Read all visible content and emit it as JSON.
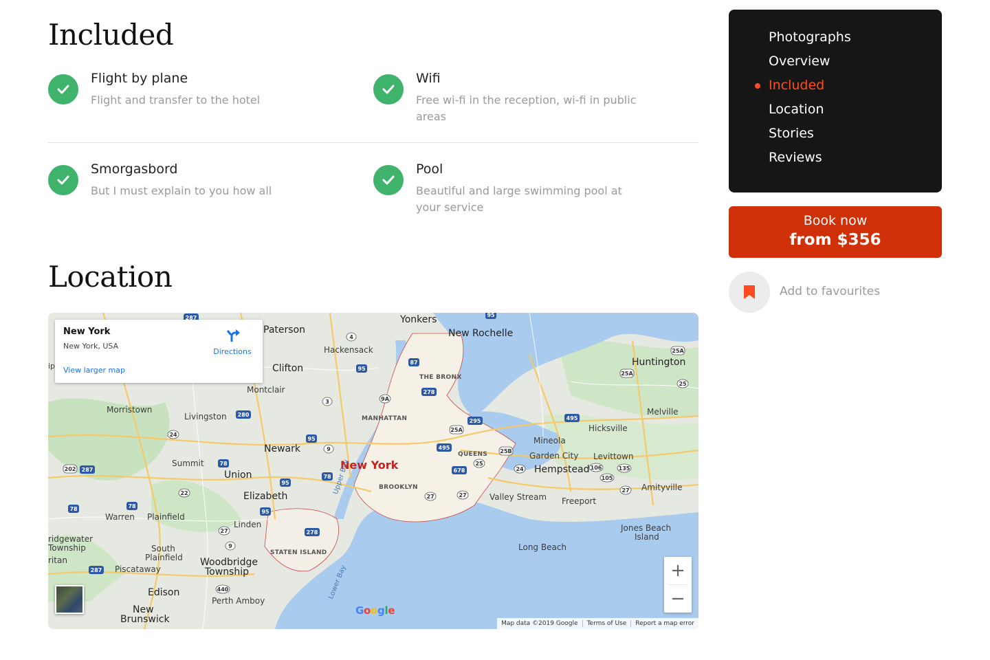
{
  "included": {
    "title": "Included",
    "items": [
      {
        "title": "Flight by plane",
        "desc": "Flight and transfer to the hotel"
      },
      {
        "title": "Wifi",
        "desc": "Free wi-fi in the reception, wi-fi in public areas"
      },
      {
        "title": "Smorgasbord",
        "desc": "But I must explain to you how all"
      },
      {
        "title": "Pool",
        "desc": "Beautiful and large swimming pool at your service"
      }
    ]
  },
  "location": {
    "title": "Location",
    "map": {
      "info_card": {
        "title": "New York",
        "subtitle": "New York, USA",
        "directions_label": "Directions",
        "larger_map_link": "View larger map"
      },
      "labels": {
        "yonkers": "Yonkers",
        "paterson": "Paterson",
        "new_rochelle": "New Rochelle",
        "hackensack": "Hackensack",
        "clifton": "Clifton",
        "huntington": "Huntington",
        "the_bronx": "THE BRONX",
        "montclair": "Montclair",
        "morristown": "Morristown",
        "livingston": "Livingston",
        "manhattan": "MANHATTAN",
        "melville": "Melville",
        "hicksville": "Hicksville",
        "mineola": "Mineola",
        "newark": "Newark",
        "queens": "QUEENS",
        "garden_city": "Garden City",
        "levittown": "Levittown",
        "summit": "Summit",
        "new_york": "New York",
        "hempstead": "Hempstead",
        "union": "Union",
        "brooklyn": "BROOKLYN",
        "amityville": "Amityville",
        "elizabeth": "Elizabeth",
        "valley_stream": "Valley Stream",
        "freeport": "Freeport",
        "warren": "Warren",
        "plainfield": "Plainfield",
        "linden": "Linden",
        "upper_bay": "Upper Bay",
        "jones_beach_1": "Jones Beach",
        "jones_beach_2": "Island",
        "bridgewater_1": "ridgewater",
        "bridgewater_2": "Township",
        "staten_island": "STATEN ISLAND",
        "long_beach": "Long Beach",
        "south_plainfield_1": "South",
        "south_plainfield_2": "Plainfield",
        "woodbridge_1": "Woodbridge",
        "woodbridge_2": "Township",
        "raritan": "ritan",
        "piscataway": "Piscataway",
        "lower_bay": "Lower Bay",
        "edison": "Edison",
        "perth_amboy": "Perth Amboy",
        "new_brunswick_1": "New",
        "new_brunswick_2": "Brunswick",
        "ip": "ip"
      },
      "shields": {
        "s287a": "287",
        "s95a": "95",
        "s4": "4",
        "s87": "87",
        "s95b": "95",
        "s25a_a": "25A",
        "s25a_b": "25A",
        "s278a": "278",
        "s25": "25",
        "s3": "3",
        "s9a": "9A",
        "s280": "280",
        "s295": "295",
        "s495a": "495",
        "s24a": "24",
        "s25a_c": "25A",
        "s95c": "95",
        "s9": "9",
        "s495b": "495",
        "s25b": "25B",
        "s78a": "78",
        "s202": "202",
        "s287b": "287",
        "s678": "678",
        "s25c": "25",
        "s24b": "24",
        "s106": "106",
        "s135": "135",
        "s78b": "78",
        "s95d": "95",
        "s105": "105",
        "s22": "22",
        "s27a": "27",
        "s27b": "27",
        "s27c": "27",
        "s78c": "78",
        "s78d": "78",
        "s95e": "95",
        "s27d": "27",
        "s278b": "278",
        "s9b": "9",
        "s287c": "287",
        "s440": "440"
      },
      "google_logo": [
        "G",
        "o",
        "o",
        "g",
        "l",
        "e"
      ],
      "attribution": [
        "Map data ©2019 Google",
        "Terms of Use",
        "Report a map error"
      ],
      "zoom_in": "+",
      "zoom_out": "−"
    }
  },
  "sidebar": {
    "nav": [
      {
        "label": "Photographs",
        "active": false
      },
      {
        "label": "Overview",
        "active": false
      },
      {
        "label": "Included",
        "active": true
      },
      {
        "label": "Location",
        "active": false
      },
      {
        "label": "Stories",
        "active": false
      },
      {
        "label": "Reviews",
        "active": false
      }
    ],
    "book": {
      "line1": "Book now",
      "line2": "from $356"
    },
    "favourites_label": "Add to favourites"
  },
  "colors": {
    "accent": "#ff4b1f",
    "book_button": "#cf3008",
    "check_green": "#3fb36b",
    "nav_bg": "#161616"
  },
  "icons": {
    "check": "check-icon",
    "bookmark": "bookmark-icon",
    "directions": "directions-icon"
  }
}
